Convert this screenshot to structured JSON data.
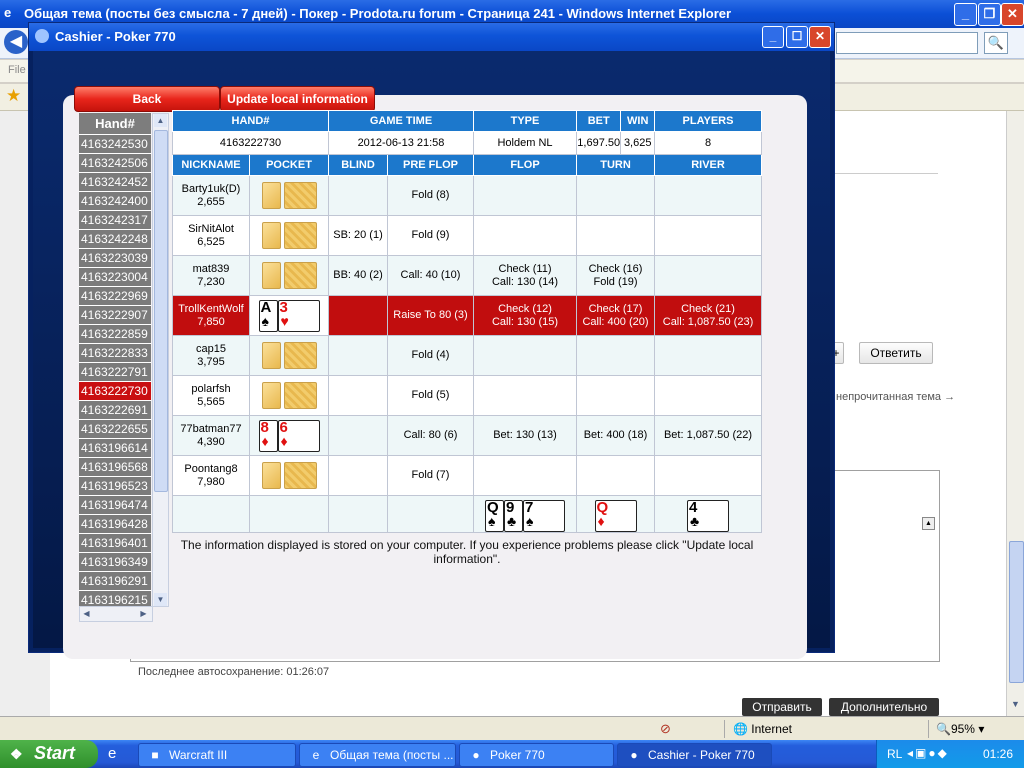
{
  "ie": {
    "title": "Общая тема (посты без смысла - 7 дней) - Покер - Prodota.ru forum - Страница 241 - Windows Internet Explorer",
    "menu_file": "File",
    "reply_button": "Ответить",
    "next_unread": "непрочитанная тема →",
    "autosave": "Последнее автосохранение: 01:26:07",
    "send_button": "Отправить",
    "more_button": "Дополнительно",
    "zone": "Internet",
    "zoom": "95%"
  },
  "cashier": {
    "title": "Cashier - Poker 770",
    "back_label": "Back",
    "update_label": "Update local information",
    "hand_list_header": "Hand#",
    "hands": [
      "4163242530",
      "4163242506",
      "4163242452",
      "4163242400",
      "4163242317",
      "4163242248",
      "4163223039",
      "4163223004",
      "4163222969",
      "4163222907",
      "4163222859",
      "4163222833",
      "4163222791",
      "4163222730",
      "4163222691",
      "4163222655",
      "4163196614",
      "4163196568",
      "4163196523",
      "4163196474",
      "4163196428",
      "4163196401",
      "4163196349",
      "4163196291",
      "4163196215"
    ],
    "selected_hand": "4163222730",
    "summary_headers": [
      "HAND#",
      "GAME TIME",
      "TYPE",
      "BET",
      "WIN",
      "PLAYERS"
    ],
    "summary": [
      "4163222730",
      "2012-06-13 21:58",
      "Holdem NL",
      "1,697.50",
      "3,625",
      "8"
    ],
    "columns": [
      "NICKNAME",
      "POCKET",
      "BLIND",
      "PRE FLOP",
      "FLOP",
      "TURN",
      "RIVER"
    ],
    "players": [
      {
        "name": "Barty1uk(D)",
        "stack": "2,655",
        "blind": "",
        "preflop": "Fold (8)",
        "flop": "",
        "turn": "",
        "river": ""
      },
      {
        "name": "SirNitAlot",
        "stack": "6,525",
        "blind": "SB: 20 (1)",
        "preflop": "Fold (9)",
        "flop": "",
        "turn": "",
        "river": ""
      },
      {
        "name": "mat839",
        "stack": "7,230",
        "blind": "BB: 40 (2)",
        "preflop": "Call: 40 (10)",
        "flop": "Check (11)\nCall: 130 (14)",
        "turn": "Check (16)\nFold (19)",
        "river": ""
      },
      {
        "name": "TrollKentWolf",
        "stack": "7,850",
        "blind": "",
        "preflop": "Raise To 80 (3)",
        "flop": "Check (12)\nCall: 130 (15)",
        "turn": "Check (17)\nCall: 400 (20)",
        "river": "Check (21)\nCall: 1,087.50 (23)"
      },
      {
        "name": "cap15",
        "stack": "3,795",
        "blind": "",
        "preflop": "Fold (4)",
        "flop": "",
        "turn": "",
        "river": ""
      },
      {
        "name": "polarfsh",
        "stack": "5,565",
        "blind": "",
        "preflop": "Fold (5)",
        "flop": "",
        "turn": "",
        "river": ""
      },
      {
        "name": "77batman77",
        "stack": "4,390",
        "blind": "",
        "preflop": "Call: 80 (6)",
        "flop": "Bet: 130 (13)",
        "turn": "Bet: 400 (18)",
        "river": "Bet: 1,087.50 (22)"
      },
      {
        "name": "Poontang8",
        "stack": "7,980",
        "blind": "",
        "preflop": "Fold (7)",
        "flop": "",
        "turn": "",
        "river": ""
      }
    ],
    "hero_cards": [
      {
        "rank": "A",
        "suit": "♠",
        "color": "blk"
      },
      {
        "rank": "3",
        "suit": "♥",
        "color": "red"
      }
    ],
    "villain_cards": [
      {
        "rank": "8",
        "suit": "♦",
        "color": "red"
      },
      {
        "rank": "6",
        "suit": "♦",
        "color": "red"
      }
    ],
    "flop_cards": [
      {
        "rank": "Q",
        "suit": "♠",
        "color": "blk"
      },
      {
        "rank": "9",
        "suit": "♣",
        "color": "blk"
      },
      {
        "rank": "7",
        "suit": "♠",
        "color": "blk"
      }
    ],
    "turn_card": {
      "rank": "Q",
      "suit": "♦",
      "color": "red"
    },
    "river_card": {
      "rank": "4",
      "suit": "♣",
      "color": "blk"
    },
    "notice": "The information displayed is stored on your computer. If you experience problems please click \"Update local information\"."
  },
  "taskbar": {
    "start": "Start",
    "tasks": [
      "Warcraft III",
      "Общая тема (посты ...",
      "Poker 770",
      "Cashier - Poker 770"
    ],
    "lang": "RL",
    "clock": "01:26"
  }
}
